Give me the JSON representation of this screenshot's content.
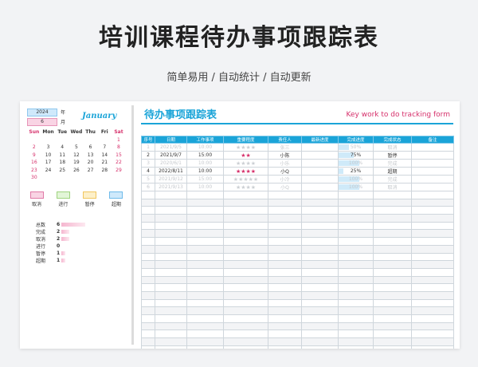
{
  "header": {
    "title": "培训课程待办事项跟踪表",
    "subtitle": "简单易用 / 自动统计 / 自动更新"
  },
  "calendar": {
    "year": "2024",
    "year_label": "年",
    "month": "6",
    "month_label": "月",
    "month_name": "January",
    "weekdays": [
      "Sun",
      "Mon",
      "Tue",
      "Wed",
      "Thu",
      "Fri",
      "Sat"
    ],
    "weeks": [
      [
        "",
        "",
        "",
        "",
        "",
        "",
        "1"
      ],
      [
        "2",
        "3",
        "4",
        "5",
        "6",
        "7",
        "8"
      ],
      [
        "9",
        "10",
        "11",
        "12",
        "13",
        "14",
        "15"
      ],
      [
        "16",
        "17",
        "18",
        "19",
        "20",
        "21",
        "22"
      ],
      [
        "23",
        "24",
        "25",
        "26",
        "27",
        "28",
        "29"
      ],
      [
        "30",
        "",
        "",
        "",
        "",
        "",
        ""
      ]
    ]
  },
  "legend": [
    {
      "label": "取消",
      "fill": "#f9d4e4",
      "border": "#e07aa7"
    },
    {
      "label": "进行",
      "fill": "#e2f5d7",
      "border": "#9fd37f"
    },
    {
      "label": "暂停",
      "fill": "#fdf0c9",
      "border": "#f1c65f"
    },
    {
      "label": "超期",
      "fill": "#cfe9fb",
      "border": "#6fbbea"
    }
  ],
  "stats": [
    {
      "label": "总数",
      "value": "6",
      "ratio": 1.0
    },
    {
      "label": "完成",
      "value": "2",
      "ratio": 0.34
    },
    {
      "label": "取消",
      "value": "2",
      "ratio": 0.34
    },
    {
      "label": "进行",
      "value": "0",
      "ratio": 0.0
    },
    {
      "label": "暂停",
      "value": "1",
      "ratio": 0.17
    },
    {
      "label": "超期",
      "value": "1",
      "ratio": 0.17
    }
  ],
  "tracker": {
    "title": "待办事项跟踪表",
    "title_en": "Key work to do tracking form",
    "columns": [
      "序号",
      "日期",
      "工作事项",
      "重要程度",
      "责任人",
      "最新进度",
      "完成进度",
      "完成状态",
      "备注"
    ],
    "rows": [
      {
        "no": "1",
        "date": "2021/9/5",
        "item": "10:00",
        "stars": 4,
        "owner": "张三",
        "latest": "",
        "pct": "50%",
        "pct_value": 0.5,
        "status": "取消",
        "note": "",
        "done": true
      },
      {
        "no": "2",
        "date": "2021/9/7",
        "item": "15:00",
        "stars": 2,
        "owner": "小陈",
        "latest": "",
        "pct": "75%",
        "pct_value": 0.75,
        "status": "暂停",
        "note": "",
        "done": false
      },
      {
        "no": "3",
        "date": "2020/6/1",
        "item": "10:00",
        "stars": 4,
        "owner": "小乐",
        "latest": "",
        "pct": "100%",
        "pct_value": 1.0,
        "status": "完成",
        "note": "",
        "done": true
      },
      {
        "no": "4",
        "date": "2022/8/11",
        "item": "10:00",
        "stars": 4,
        "owner": "小Q",
        "latest": "",
        "pct": "25%",
        "pct_value": 0.25,
        "status": "超期",
        "note": "",
        "done": false
      },
      {
        "no": "5",
        "date": "2021/9/12",
        "item": "15:00",
        "stars": 5,
        "owner": "小冷",
        "latest": "",
        "pct": "100%",
        "pct_value": 1.0,
        "status": "完成",
        "note": "",
        "done": true
      },
      {
        "no": "6",
        "date": "2021/9/13",
        "item": "10:00",
        "stars": 4,
        "owner": "小Q",
        "latest": "",
        "pct": "100%",
        "pct_value": 1.0,
        "status": "取消",
        "note": "",
        "done": true
      }
    ],
    "star_glyph": "★",
    "blank_rows": 21
  }
}
